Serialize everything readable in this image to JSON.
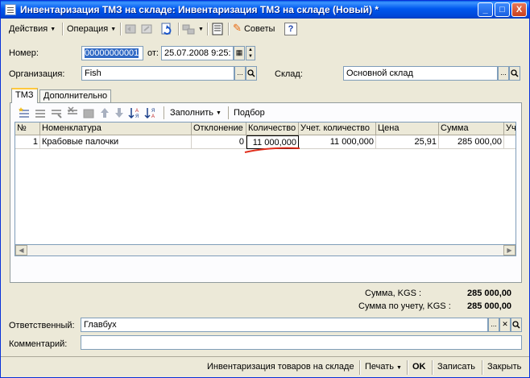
{
  "window": {
    "title": "Инвентаризация ТМЗ на складе: Инвентаризация ТМЗ на складе (Новый) *",
    "minimize_glyph": "_",
    "maximize_glyph": "□",
    "close_glyph": "X"
  },
  "toolbar": {
    "actions_label": "Действия",
    "operation_label": "Операция",
    "tips_label": "Советы",
    "help_label": "?"
  },
  "form": {
    "number_label": "Номер:",
    "number_value": "00000000001",
    "date_label": "от:",
    "date_value": "25.07.2008  9:25:",
    "org_label": "Организация:",
    "org_value": "Fish",
    "warehouse_label": "Склад:",
    "warehouse_value": "Основной склад",
    "ellipsis": "...",
    "search_glyph": "🔍"
  },
  "tabs": [
    {
      "label": "ТМЗ"
    },
    {
      "label": "Дополнительно"
    }
  ],
  "table_toolbar": {
    "fill_label": "Заполнить",
    "select_label": "Подбор"
  },
  "table": {
    "columns": [
      "№",
      "Номенклатура",
      "Отклонение",
      "Количество",
      "Учет. количество",
      "Цена",
      "Сумма",
      "Уч"
    ],
    "rows": [
      {
        "num": "1",
        "item": "Крабовые палочки",
        "deviation": "0",
        "qty": "11 000,000",
        "acc_qty": "11 000,000",
        "price": "25,91",
        "sum": "285 000,00",
        "extra": ""
      }
    ]
  },
  "totals": {
    "sum_label": "Сумма, KGS :",
    "sum_value": "285 000,00",
    "acc_sum_label": "Сумма по учету, KGS :",
    "acc_sum_value": "285 000,00"
  },
  "footer": {
    "responsible_label": "Ответственный:",
    "responsible_value": "Главбух",
    "comment_label": "Комментарий:",
    "comment_value": "",
    "clear_glyph": "✕"
  },
  "bottom": {
    "report_label": "Инвентаризация товаров на складе",
    "print_label": "Печать",
    "ok_label": "OK",
    "save_label": "Записать",
    "close_label": "Закрыть"
  },
  "colors": {
    "title_bar": "#0058EE",
    "window_bg": "#ECE9D8",
    "selection": "#316AC5",
    "annotation_underline": "#E0301E"
  }
}
